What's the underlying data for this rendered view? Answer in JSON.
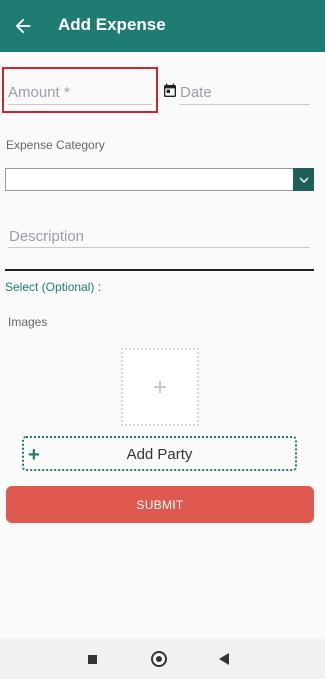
{
  "header": {
    "title": "Add Expense",
    "back_icon": "arrow-left-icon"
  },
  "form": {
    "amount_placeholder": "Amount *",
    "date_placeholder": "Date",
    "calendar_icon": "calendar-icon",
    "expense_category_label": "Expense Category",
    "category_value": "",
    "description_placeholder": "Description",
    "select_optional": "Select (Optional) :",
    "images_label": "Images",
    "image_add_icon": "plus-icon",
    "add_party_label": "Add Party",
    "submit_label": "SUBMIT"
  },
  "colors": {
    "primary": "#1f7c72",
    "highlight": "#d1262c",
    "submit": "#de5a4f"
  },
  "system_nav": {
    "recent_icon": "square-icon",
    "home_icon": "home-circle-icon",
    "back_icon": "triangle-back-icon"
  }
}
